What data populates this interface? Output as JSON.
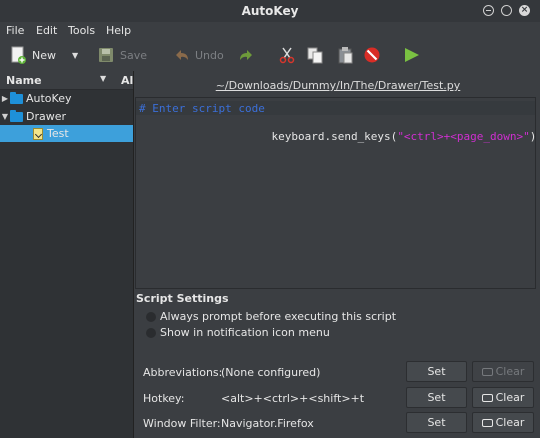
{
  "window": {
    "title": "AutoKey"
  },
  "menu": [
    "File",
    "Edit",
    "Tools",
    "Help"
  ],
  "toolbar": {
    "new": "New",
    "save": "Save",
    "undo": "Undo"
  },
  "tree": {
    "col_name": "Name",
    "col_abbr": "Al",
    "items": [
      {
        "label": "AutoKey"
      },
      {
        "label": "Drawer"
      },
      {
        "label": "Test"
      }
    ]
  },
  "editor": {
    "path": "~/Downloads/Dummy/In/The/Drawer/Test.py",
    "comment": "# Enter script code",
    "code_prefix": "keyboard.send_keys(",
    "code_string": "\"<ctrl>+<page_down>\"",
    "code_suffix": ")"
  },
  "settings": {
    "title": "Script Settings",
    "opt_prompt": "Always prompt before executing this script",
    "opt_notify": "Show in notification icon menu",
    "abbr_label": "Abbreviations:",
    "abbr_value": "(None configured)",
    "hotkey_label": "Hotkey:",
    "hotkey_value": "<alt>+<ctrl>+<shift>+t",
    "filter_label": "Window Filter:",
    "filter_value": "Navigator.Firefox",
    "set_label": "Set",
    "clear_label": "Clear"
  }
}
